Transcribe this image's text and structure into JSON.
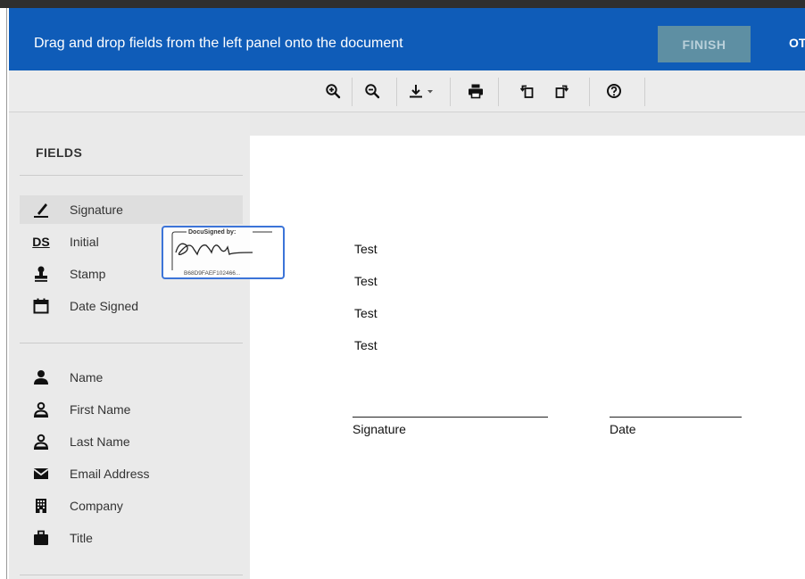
{
  "banner": {
    "instruction": "Drag and drop fields from the left panel onto the document",
    "finish_label": "FINISH",
    "other_label": "OT"
  },
  "toolbar": {
    "buttons": [
      "zoom-in-icon",
      "zoom-out-icon",
      "download-icon",
      "print-icon",
      "rotate-left-icon",
      "rotate-right-icon",
      "help-icon"
    ]
  },
  "sidebar": {
    "title": "FIELDS",
    "group1": [
      {
        "label": "Signature",
        "icon": "signature-pen-icon"
      },
      {
        "label": "Initial",
        "icon": "initials-ds-icon"
      },
      {
        "label": "Stamp",
        "icon": "stamp-icon"
      },
      {
        "label": "Date Signed",
        "icon": "calendar-icon"
      }
    ],
    "group2": [
      {
        "label": "Name",
        "icon": "person-icon"
      },
      {
        "label": "First Name",
        "icon": "person-outline-icon"
      },
      {
        "label": "Last Name",
        "icon": "person-outline-icon"
      },
      {
        "label": "Email Address",
        "icon": "envelope-icon"
      },
      {
        "label": "Company",
        "icon": "building-icon"
      },
      {
        "label": "Title",
        "icon": "briefcase-icon"
      }
    ],
    "ds_initial_text": "DS"
  },
  "dragged_signature": {
    "header": "DocuSigned by:",
    "id": "B68D9FAEF102466..."
  },
  "document": {
    "lines": [
      "Test",
      "Test",
      "Test",
      "Test"
    ],
    "signature_label": "Signature",
    "date_label": "Date"
  },
  "colors": {
    "banner": "#0f5cb8",
    "finish_disabled": "#5e8fa3",
    "drag_border": "#3c74d8"
  }
}
